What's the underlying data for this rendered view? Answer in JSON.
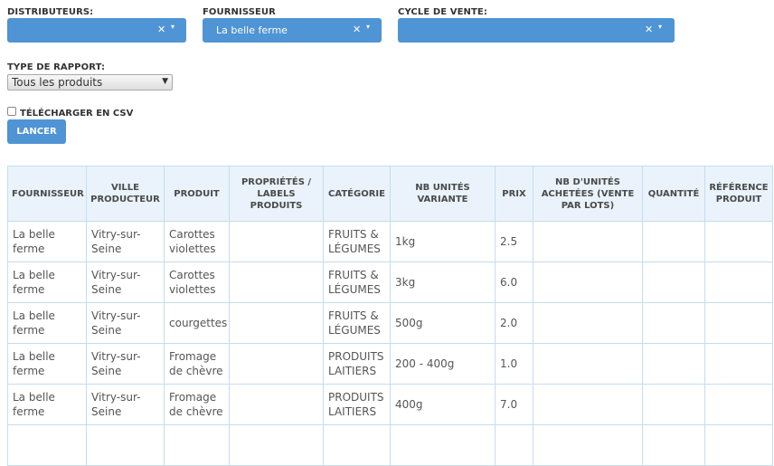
{
  "filters": {
    "distributeurs": {
      "label": "DISTRIBUTEURS:",
      "value": "",
      "clear": "✕",
      "caret": "▾"
    },
    "fournisseur": {
      "label": "FOURNISSEUR",
      "value": "La belle ferme",
      "clear": "✕",
      "caret": "▾"
    },
    "cycle": {
      "label": "CYCLE DE VENTE:",
      "value": "",
      "clear": "✕",
      "caret": "▾"
    },
    "type_rapport": {
      "label": "TYPE DE RAPPORT:",
      "value": "Tous les produits",
      "arrow": "▼"
    }
  },
  "csv_label": "TÉLÉCHARGER EN CSV",
  "submit_label": "LANCER",
  "table": {
    "headers": [
      "FOURNISSEUR",
      "VILLE PRODUCTEUR",
      "PRODUIT",
      "PROPRIÉTÉS / LABELS PRODUITS",
      "CATÉGORIE",
      "NB UNITÉS VARIANTE",
      "PRIX",
      "NB D'UNITÉS ACHETÉES (VENTE PAR LOTS)",
      "QUANTITÉ",
      "RÉFÉRENCE PRODUIT"
    ],
    "rows": [
      [
        "La belle ferme",
        "Vitry-sur-Seine",
        "Carottes violettes",
        "",
        "FRUITS & LÉGUMES",
        "1kg",
        "2.5",
        "",
        "",
        ""
      ],
      [
        "La belle ferme",
        "Vitry-sur-Seine",
        "Carottes violettes",
        "",
        "FRUITS & LÉGUMES",
        "3kg",
        "6.0",
        "",
        "",
        ""
      ],
      [
        "La belle ferme",
        "Vitry-sur-Seine",
        "courgettes",
        "",
        "FRUITS & LÉGUMES",
        "500g",
        "2.0",
        "",
        "",
        ""
      ],
      [
        "La belle ferme",
        "Vitry-sur-Seine",
        "Fromage de chèvre",
        "",
        "PRODUITS LAITIERS",
        "200 - 400g",
        "1.0",
        "",
        "",
        ""
      ],
      [
        "La belle ferme",
        "Vitry-sur-Seine",
        "Fromage de chèvre",
        "",
        "PRODUITS LAITIERS",
        "400g",
        "7.0",
        "",
        "",
        ""
      ],
      [
        "",
        "",
        "",
        "",
        "",
        "",
        "",
        "",
        "",
        ""
      ]
    ]
  }
}
